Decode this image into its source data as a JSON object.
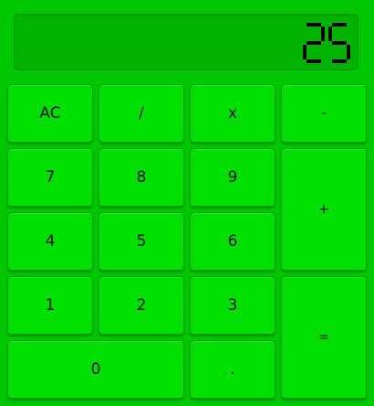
{
  "display": {
    "value": "25"
  },
  "buttons": {
    "clear": "AC",
    "divide": "/",
    "multiply": "x",
    "subtract": "-",
    "seven": "7",
    "eight": "8",
    "nine": "9",
    "add": "+",
    "four": "4",
    "five": "5",
    "six": "6",
    "one": "1",
    "two": "2",
    "three": "3",
    "equals": "=",
    "zero": "0",
    "decimal": "."
  },
  "colors": {
    "background": "#00c800",
    "button": "#00e000",
    "display": "#00b300",
    "digit": "#000000"
  }
}
